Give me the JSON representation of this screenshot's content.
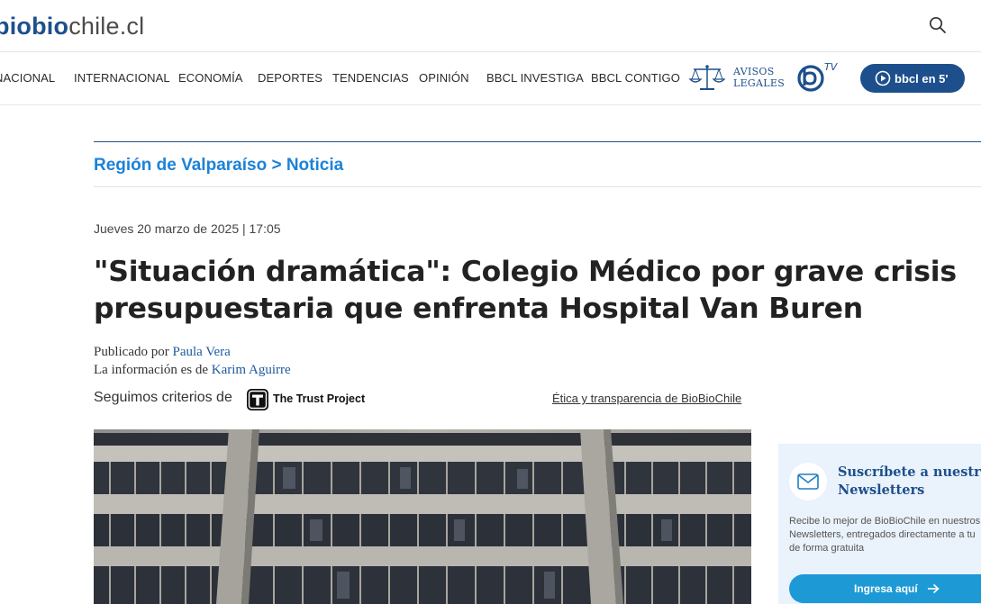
{
  "header": {
    "logo_part1": "biobio",
    "logo_part2": "chile.cl"
  },
  "nav": {
    "items": [
      "NACIONAL",
      "INTERNACIONAL",
      "ECONOMÍA",
      "DEPORTES",
      "TENDENCIAS",
      "OPINIÓN",
      "BBCL INVESTIGA",
      "BBCL CONTIGO"
    ],
    "avisos_line1": "AVISOS",
    "avisos_line2": "LEGALES",
    "tv_label": "TV",
    "bbcl5_label": "bbcl en 5'"
  },
  "section": {
    "region": "Región de Valparaíso",
    "separator": " > ",
    "type": "Noticia"
  },
  "article": {
    "date": "Jueves 20 marzo de 2025 | 17:05",
    "title": "\"Situación dramática\": Colegio Médico por grave crisis presupuestaria que enfrenta Hospital Van Buren",
    "published_by_label": "Publicado por ",
    "author": "Paula Vera",
    "info_label": "La información es de ",
    "source_author": "Karim Aguirre",
    "trust_label": "Seguimos criterios de",
    "trust_name": "The Trust Project",
    "ethics_link": "Ética y transparencia de BioBioChile"
  },
  "newsletter": {
    "title_line1": "Suscríbete a nuestros",
    "title_line2": "Newsletters",
    "desc_line1": "Recibe lo mejor de BioBioChile en nuestros",
    "desc_line2": "Newsletters, entregados directamente a tu",
    "desc_line3": "de forma gratuita",
    "button": "Ingresa aquí"
  },
  "colors": {
    "brand_blue": "#1d4f8c",
    "link_blue": "#1c82d8",
    "newsletter_bg": "#eaf2fb",
    "newsletter_button": "#1d9ad6"
  }
}
